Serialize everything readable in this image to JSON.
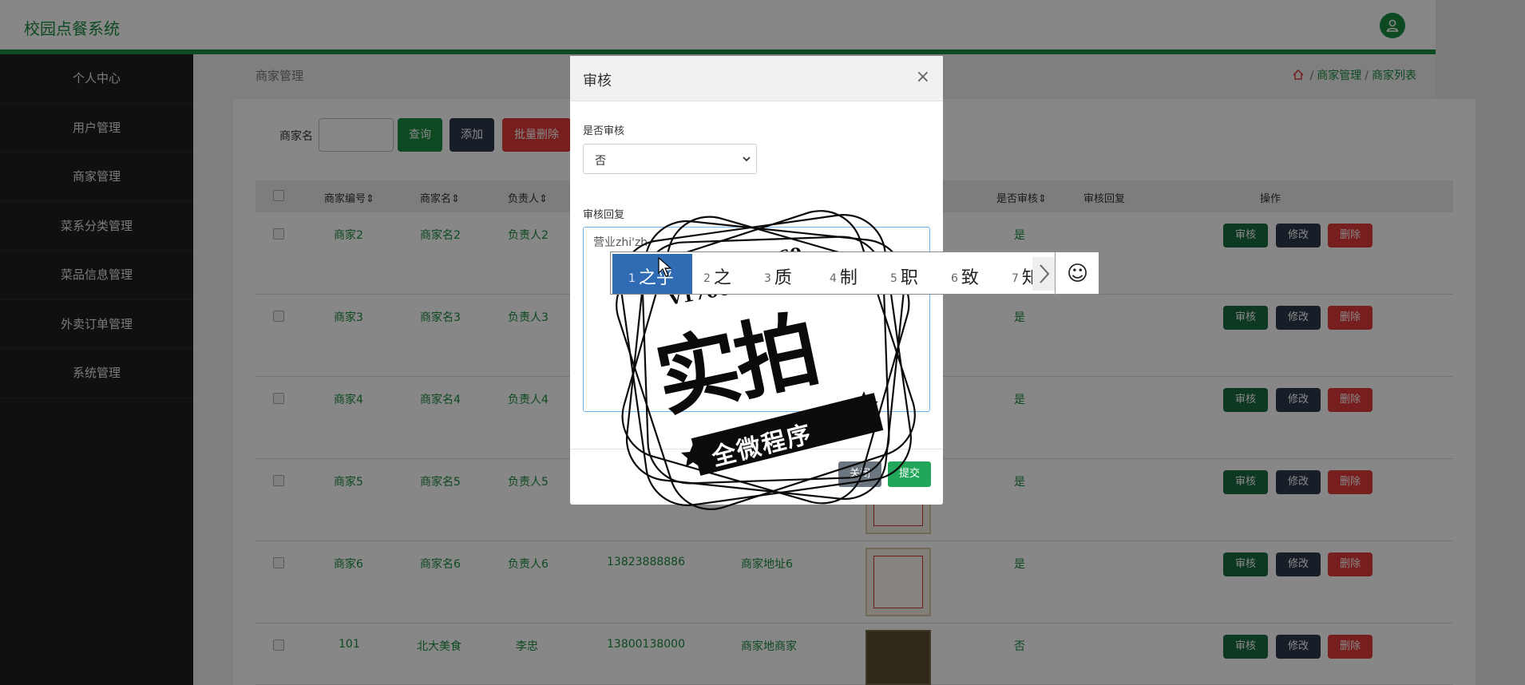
{
  "app": {
    "title": "校园点餐系统"
  },
  "sidebar": {
    "items": [
      {
        "label": "个人中心"
      },
      {
        "label": "用户管理"
      },
      {
        "label": "商家管理"
      },
      {
        "label": "菜系分类管理"
      },
      {
        "label": "菜品信息管理"
      },
      {
        "label": "外卖订单管理"
      },
      {
        "label": "系统管理"
      }
    ]
  },
  "page": {
    "title": "商家管理",
    "breadcrumb": {
      "level1": "商家管理",
      "level2": "商家列表",
      "sep": "/"
    }
  },
  "search": {
    "label": "商家名",
    "query_label": "查询",
    "add_label": "添加",
    "batch_delete_label": "批量删除"
  },
  "table": {
    "headers": [
      "商家编号",
      "商家名",
      "负责人",
      "是否审核",
      "审核回复",
      "操作"
    ],
    "rows": [
      {
        "id": "商家2",
        "name": "商家名2",
        "owner": "负责人2",
        "phone": "",
        "address": "",
        "audit": "是"
      },
      {
        "id": "商家3",
        "name": "商家名3",
        "owner": "负责人3",
        "phone": "",
        "address": "",
        "audit": "是"
      },
      {
        "id": "商家4",
        "name": "商家名4",
        "owner": "负责人4",
        "phone": "",
        "address": "",
        "audit": "是"
      },
      {
        "id": "商家5",
        "name": "商家名5",
        "owner": "负责人5",
        "phone": "",
        "address": "",
        "audit": "是"
      },
      {
        "id": "商家6",
        "name": "商家名6",
        "owner": "负责人6",
        "phone": "13823888886",
        "address": "商家地址6",
        "audit": "是"
      },
      {
        "id": "101",
        "name": "北大美食",
        "owner": "李忠",
        "phone": "13800138000",
        "address": "商家地商家",
        "audit": "否"
      }
    ],
    "row_actions": {
      "audit": "审核",
      "edit": "修改",
      "delete": "删除"
    }
  },
  "modal": {
    "title": "审核",
    "close_glyph": "×",
    "field_audit_label": "是否审核",
    "field_audit_value": "否",
    "field_reply_label": "审核回复",
    "field_reply_value": "营业zhi'zh",
    "close_label": "关闭",
    "submit_label": "提交"
  },
  "ime": {
    "candidates": [
      {
        "n": "1",
        "text": "之乎"
      },
      {
        "n": "2",
        "text": "之"
      },
      {
        "n": "3",
        "text": "质"
      },
      {
        "n": "4",
        "text": "制"
      },
      {
        "n": "5",
        "text": "职"
      },
      {
        "n": "6",
        "text": "致"
      },
      {
        "n": "7",
        "text": "知"
      }
    ],
    "emoji_glyph": "☺"
  },
  "watermark": {
    "contact_q": "Q2196316269",
    "contact_v": "V17060256499",
    "big_text": "实拍",
    "ribbon_text": "全微程序"
  },
  "colors": {
    "brand": "#1a8a3f",
    "danger": "#e03a3a",
    "dark": "#2f3a4a",
    "ime_highlight": "#2f6cb4"
  }
}
